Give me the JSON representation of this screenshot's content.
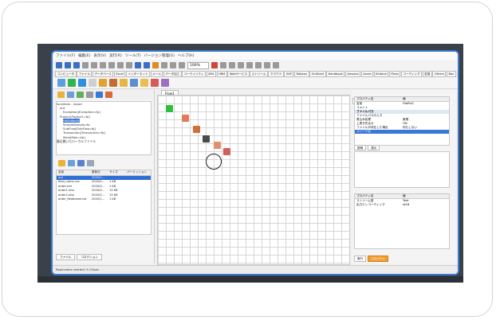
{
  "menu": [
    "ファイル(F)",
    "編集(E)",
    "表示(V)",
    "実行(R)",
    "ツール(T)",
    "バージョン管理(G)",
    "ヘルプ(H)"
  ],
  "toolbar": {
    "zoom_value": "100%"
  },
  "component_tabs": [
    "コンピュータ",
    "ファイル",
    "データベース",
    "Excel",
    "インターネット",
    "メール",
    "データ加工",
    "ユーティリティ",
    "XML",
    "HBM",
    "Webサービス",
    "ストリーム",
    "クラウド",
    "SAP",
    "Tableau",
    "OnSheet",
    "Handbook",
    "Amazon",
    "Azure",
    "Kintone",
    "Plans",
    "コーディング",
    "変換",
    "Others",
    "Box"
  ],
  "tree": [
    "localhost - /quad",
    "out",
    "Exception[Exception.rfp]",
    "Project(Project1.rfp)",
    "HelloWorld",
    "SimpleSample.rfp",
    "SubFlow[SubFlow.rfp]",
    "Transaction[Transaction.rfp]",
    "Main[Main.rfp]",
    "最近開いたローカルファイル"
  ],
  "files": {
    "headers": [
      "名前",
      "更新日",
      "サイズ",
      "パーミッション"
    ],
    "rows": [
      [
        "out",
        "2020/1...",
        "",
        ""
      ],
      [
        "field_name.csv",
        "2020/0...",
        "1 KB",
        ""
      ],
      [
        "order.xml",
        "2020/0...",
        "1 KB",
        ""
      ],
      [
        "order1.xlsx",
        "2020/0...",
        "13 KB",
        ""
      ],
      [
        "order2.xlsx",
        "2020/0...",
        "13 KB",
        ""
      ],
      [
        "order_fieldname.txt",
        "2020/1...",
        "1 KB",
        ""
      ]
    ]
  },
  "left_tabs": [
    "ファイル",
    "コネクション"
  ],
  "canvas_tab": "Flow1",
  "right": {
    "top_tab": "表示",
    "props_header": [
      "プロパティ名",
      "値"
    ],
    "props": [
      {
        "k": "名前",
        "v": "FilePut1",
        "type": ""
      },
      {
        "k": "コメント",
        "v": "",
        "type": ""
      },
      {
        "k": "ファイルパス",
        "v": "",
        "type": "sec"
      },
      {
        "k": "ファイルパスの入力",
        "v": "",
        "type": ""
      },
      {
        "k": "書込み処理",
        "v": "新規",
        "type": ""
      },
      {
        "k": "上書き先合せ",
        "v": "ON",
        "type": ""
      },
      {
        "k": "ファイルが存在した場合",
        "v": "何もしない",
        "type": ""
      },
      {
        "k": "ユニーク名",
        "v": "",
        "type": "hl"
      }
    ],
    "desc_tabs": [
      "説明",
      "表示"
    ],
    "props2_header": [
      "プロパティ名",
      "値"
    ],
    "props2": [
      {
        "k": "ストリーム型",
        "v": "Text"
      },
      {
        "k": "出力エンコーディング",
        "v": "utf-8"
      }
    ],
    "bottom_tabs": [
      "実行",
      "プロパティ"
    ]
  },
  "status": "Replication started: 9.19/sec"
}
